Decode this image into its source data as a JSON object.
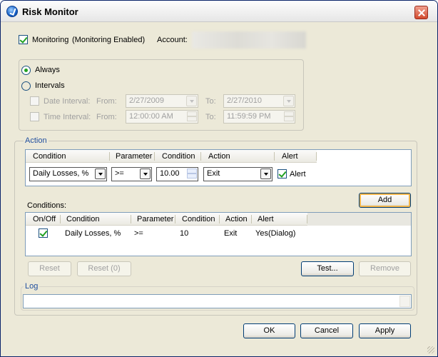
{
  "window": {
    "title": "Risk Monitor"
  },
  "monitoring": {
    "label": "Monitoring",
    "status": "(Monitoring Enabled)",
    "checked": true,
    "account_label": "Account:"
  },
  "schedule": {
    "always_label": "Always",
    "intervals_label": "Intervals",
    "date_interval_label": "Date Interval:",
    "time_interval_label": "Time Interval:",
    "from_label": "From:",
    "to_label": "To:",
    "date_from": "2/27/2009",
    "date_to": "2/27/2010",
    "time_from": "12:00:00 AM",
    "time_to": "11:59:59 PM"
  },
  "action_group": {
    "title": "Action",
    "headers": [
      "Condition",
      "Parameter",
      "Condition",
      "Action",
      "Alert"
    ],
    "condition_value": "Daily Losses, %",
    "parameter_value": ">=",
    "threshold_value": "10.00",
    "action_value": "Exit",
    "alert_label": "Alert",
    "alert_checked": true
  },
  "conditions": {
    "label": "Conditions:",
    "add_button": "Add",
    "headers": [
      "On/Off",
      "Condition",
      "Parameter",
      "Condition",
      "Action",
      "Alert"
    ],
    "rows": [
      {
        "on": true,
        "condition": "Daily Losses, %",
        "parameter": ">=",
        "value": "10",
        "action": "Exit",
        "alert": "Yes(Dialog)"
      }
    ],
    "reset_button": "Reset",
    "reset_zero_button": "Reset (0)",
    "test_button": "Test...",
    "remove_button": "Remove"
  },
  "log": {
    "title": "Log"
  },
  "footer": {
    "ok": "OK",
    "cancel": "Cancel",
    "apply": "Apply"
  }
}
